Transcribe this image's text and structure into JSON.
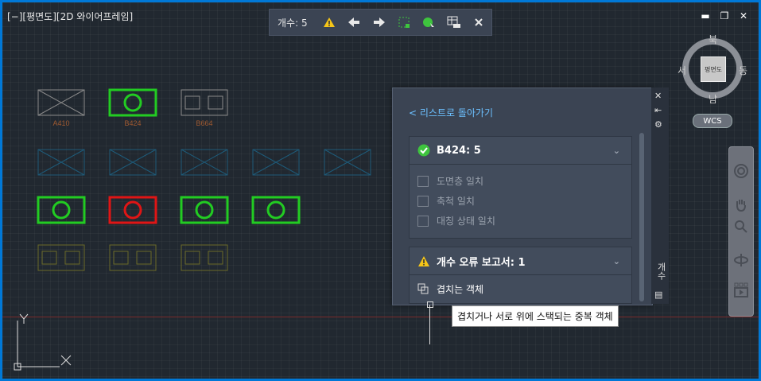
{
  "viewport_label": "[−][평면도][2D 와이어프레임]",
  "toolbar": {
    "count_label": "개수:",
    "count_value": "5"
  },
  "viewcube": {
    "face": "평면도",
    "north": "북",
    "south": "남",
    "east": "동",
    "west": "서",
    "wcs": "WCS"
  },
  "drawing": {
    "blocks_row1": [
      "A410",
      "B424",
      "B664"
    ]
  },
  "panel": {
    "back_link": "< 리스트로 돌아가기",
    "card1_title": "B424: 5",
    "checks": [
      "도면층 일치",
      "축척 일치",
      "대칭 상태 일치"
    ],
    "card2_title": "개수 오류 보고서: 1",
    "overlap_label": "겹치는 객체",
    "side_label": "개수"
  },
  "tooltip": "겹치거나 서로 위에 스택되는 중복 객체",
  "colors": {
    "accent_link": "#6cc0ff",
    "ok_green": "#3ec43e",
    "warn_yellow": "#f5c518",
    "error_red": "#e01515"
  }
}
